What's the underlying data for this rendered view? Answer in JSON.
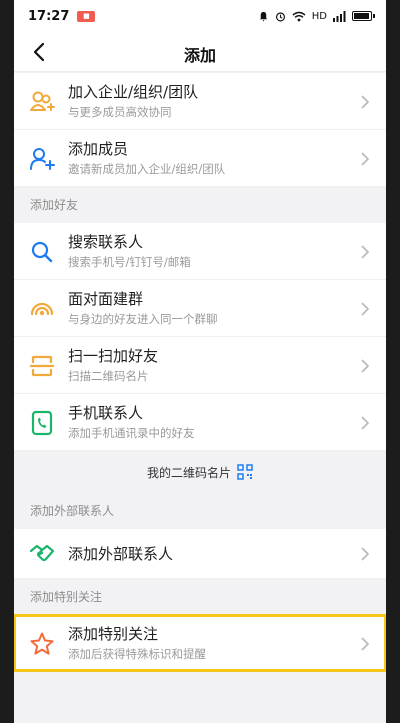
{
  "status_bar": {
    "time": "17:27",
    "badge": "■",
    "network": "HD",
    "battery_level": 0.85
  },
  "nav": {
    "title": "添加"
  },
  "enterprise": [
    {
      "title": "加入企业/组织/团队",
      "subtitle": "与更多成员高效协同",
      "icon": "team-join-icon",
      "color": "#f2a93b"
    },
    {
      "title": "添加成员",
      "subtitle": "邀请新成员加入企业/组织/团队",
      "icon": "add-member-icon",
      "color": "#1e7cf2"
    }
  ],
  "friends_section": {
    "header": "添加好友"
  },
  "friends": [
    {
      "title": "搜索联系人",
      "subtitle": "搜索手机号/钉钉号/邮箱",
      "icon": "search-icon",
      "color": "#1e7cf2"
    },
    {
      "title": "面对面建群",
      "subtitle": "与身边的好友进入同一个群聊",
      "icon": "face-to-face-icon",
      "color": "#f2a93b"
    },
    {
      "title": "扫一扫加好友",
      "subtitle": "扫描二维码名片",
      "icon": "scan-icon",
      "color": "#f2a93b"
    },
    {
      "title": "手机联系人",
      "subtitle": "添加手机通讯录中的好友",
      "icon": "phone-contacts-icon",
      "color": "#19b56a"
    }
  ],
  "qr_card": {
    "label": "我的二维码名片",
    "icon": "qr-code-icon",
    "color": "#1e7cf2"
  },
  "external_section": {
    "header": "添加外部联系人"
  },
  "external": [
    {
      "title": "添加外部联系人",
      "subtitle": "",
      "icon": "handshake-icon",
      "color": "#19b56a"
    }
  ],
  "special_section": {
    "header": "添加特别关注"
  },
  "special": [
    {
      "title": "添加特别关注",
      "subtitle": "添加后获得特殊标识和提醒",
      "icon": "star-icon",
      "color": "#f26b3b"
    }
  ]
}
